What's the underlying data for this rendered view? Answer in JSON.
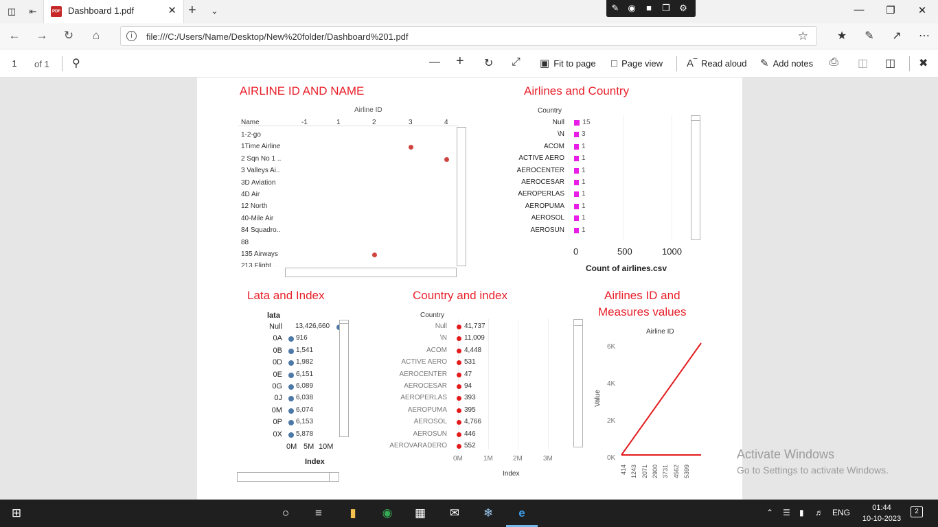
{
  "browser": {
    "tab_title": "Dashboard 1.pdf",
    "url": "file:///C:/Users/Name/Desktop/New%20folder/Dashboard%201.pdf"
  },
  "pdf_toolbar": {
    "page_number": "1",
    "page_count": "of 1",
    "fit_to_page": "Fit to page",
    "page_view": "Page view",
    "read_aloud": "Read aloud",
    "add_notes": "Add notes"
  },
  "dashboard": {
    "airline_id_name": {
      "title": "AIRLINE ID AND NAME",
      "axis_title": "Airline ID",
      "col_header": "Name",
      "ticks": [
        "-1",
        "1",
        "2",
        "3",
        "4"
      ],
      "rows": [
        {
          "name": "1-2-go",
          "id": null
        },
        {
          "name": "1Time Airline",
          "id": 3
        },
        {
          "name": "2 Sqn No 1 ..",
          "id": 4
        },
        {
          "name": "3 Valleys Ai..",
          "id": null
        },
        {
          "name": "3D Aviation",
          "id": null
        },
        {
          "name": "4D Air",
          "id": null
        },
        {
          "name": "12 North",
          "id": null
        },
        {
          "name": "40-Mile Air",
          "id": null
        },
        {
          "name": "84 Squadro..",
          "id": null
        },
        {
          "name": "88",
          "id": null
        },
        {
          "name": "135 Airways",
          "id": 2
        },
        {
          "name": "213 Flight ..",
          "id": null
        }
      ]
    },
    "airlines_country": {
      "title": "Airlines and Country",
      "row_header": "Country",
      "x_label": "Count of airlines.csv",
      "x_ticks": [
        "0",
        "500",
        "1000"
      ],
      "rows": [
        {
          "country": "Null",
          "count": 15
        },
        {
          "country": "\\N",
          "count": 3
        },
        {
          "country": "ACOM",
          "count": 1
        },
        {
          "country": "ACTIVE AERO",
          "count": 1
        },
        {
          "country": "AEROCENTER",
          "count": 1
        },
        {
          "country": "AEROCESAR",
          "count": 1
        },
        {
          "country": "AEROPERLAS",
          "count": 1
        },
        {
          "country": "AEROPUMA",
          "count": 1
        },
        {
          "country": "AEROSOL",
          "count": 1
        },
        {
          "country": "AEROSUN",
          "count": 1
        }
      ],
      "bar_color": "#e81ee6"
    },
    "lata_index": {
      "title": "Lata and Index",
      "row_header": "lata",
      "x_label": "Index",
      "x_ticks": [
        "0M",
        "5M",
        "10M"
      ],
      "rows": [
        {
          "label": "Null",
          "value": "13,426,660"
        },
        {
          "label": "0A",
          "value": "916"
        },
        {
          "label": "0B",
          "value": "1,541"
        },
        {
          "label": "0D",
          "value": "1,982"
        },
        {
          "label": "0E",
          "value": "6,151"
        },
        {
          "label": "0G",
          "value": "6,089"
        },
        {
          "label": "0J",
          "value": "6,038"
        },
        {
          "label": "0M",
          "value": "6,074"
        },
        {
          "label": "0P",
          "value": "6,153"
        },
        {
          "label": "0X",
          "value": "5,878"
        }
      ],
      "dot_color": "#4e79a7"
    },
    "country_index": {
      "title": "Country and index",
      "row_header": "Country",
      "x_label": "Index",
      "x_ticks": [
        "0M",
        "1M",
        "2M",
        "3M"
      ],
      "rows": [
        {
          "label": "Null",
          "value": "41,737"
        },
        {
          "label": "\\N",
          "value": "11,009"
        },
        {
          "label": "ACOM",
          "value": "4,448"
        },
        {
          "label": "ACTIVE AERO",
          "value": "531"
        },
        {
          "label": "AEROCENTER",
          "value": "47"
        },
        {
          "label": "AEROCESAR",
          "value": "94"
        },
        {
          "label": "AEROPERLAS",
          "value": "393"
        },
        {
          "label": "AEROPUMA",
          "value": "395"
        },
        {
          "label": "AEROSOL",
          "value": "4,766"
        },
        {
          "label": "AEROSUN",
          "value": "446"
        },
        {
          "label": "AEROVARADERO",
          "value": "552"
        }
      ],
      "dot_color": "#e31a1c"
    },
    "measures": {
      "title_line1": "Airlines ID and",
      "title_line2": "Measures values",
      "axis_title": "Airline ID",
      "y_label": "Value",
      "y_ticks": [
        "6K",
        "4K",
        "2K",
        "0K"
      ],
      "x_ticks": [
        "414",
        "1243",
        "2071",
        "2900",
        "3731",
        "4562",
        "5399"
      ],
      "line_color": "#e31a1c"
    }
  },
  "chart_data": [
    {
      "type": "scatter",
      "title": "AIRLINE ID AND NAME",
      "xlabel": "Airline ID",
      "ylabel": "Name",
      "categories": [
        "1Time Airline",
        "2 Sqn No 1 ..",
        "135 Airways"
      ],
      "values": [
        3,
        4,
        2
      ]
    },
    {
      "type": "bar",
      "title": "Airlines and Country",
      "xlabel": "Count of airlines.csv",
      "ylabel": "Country",
      "categories": [
        "Null",
        "\\N",
        "ACOM",
        "ACTIVE AERO",
        "AEROCENTER",
        "AEROCESAR",
        "AEROPERLAS",
        "AEROPUMA",
        "AEROSOL",
        "AEROSUN"
      ],
      "values": [
        15,
        3,
        1,
        1,
        1,
        1,
        1,
        1,
        1,
        1
      ],
      "xlim": [
        0,
        1250
      ]
    },
    {
      "type": "scatter",
      "title": "Lata and Index",
      "xlabel": "Index",
      "ylabel": "lata",
      "categories": [
        "Null",
        "0A",
        "0B",
        "0D",
        "0E",
        "0G",
        "0J",
        "0M",
        "0P",
        "0X"
      ],
      "values": [
        13426660,
        916,
        1541,
        1982,
        6151,
        6089,
        6038,
        6074,
        6153,
        5878
      ]
    },
    {
      "type": "scatter",
      "title": "Country and index",
      "xlabel": "Index",
      "ylabel": "Country",
      "categories": [
        "Null",
        "\\N",
        "ACOM",
        "ACTIVE AERO",
        "AEROCENTER",
        "AEROCESAR",
        "AEROPERLAS",
        "AEROPUMA",
        "AEROSOL",
        "AEROSUN",
        "AEROVARADERO"
      ],
      "values": [
        41737,
        11009,
        4448,
        531,
        47,
        94,
        393,
        395,
        4766,
        446,
        552
      ]
    },
    {
      "type": "line",
      "title": "Airlines ID and Measures values",
      "xlabel": "Airline ID",
      "ylabel": "Value",
      "series": [
        {
          "values_x": [
            0,
            6000
          ],
          "values": [
            0,
            6000
          ]
        },
        {
          "values_x": [
            0,
            6000
          ],
          "values": [
            0,
            0
          ]
        }
      ],
      "ylim": [
        0,
        6000
      ]
    }
  ],
  "watermark": {
    "line1": "Activate Windows",
    "line2": "Go to Settings to activate Windows."
  },
  "taskbar": {
    "language": "ENG",
    "time": "01:44",
    "date": "10-10-2023",
    "notifications": "2"
  }
}
